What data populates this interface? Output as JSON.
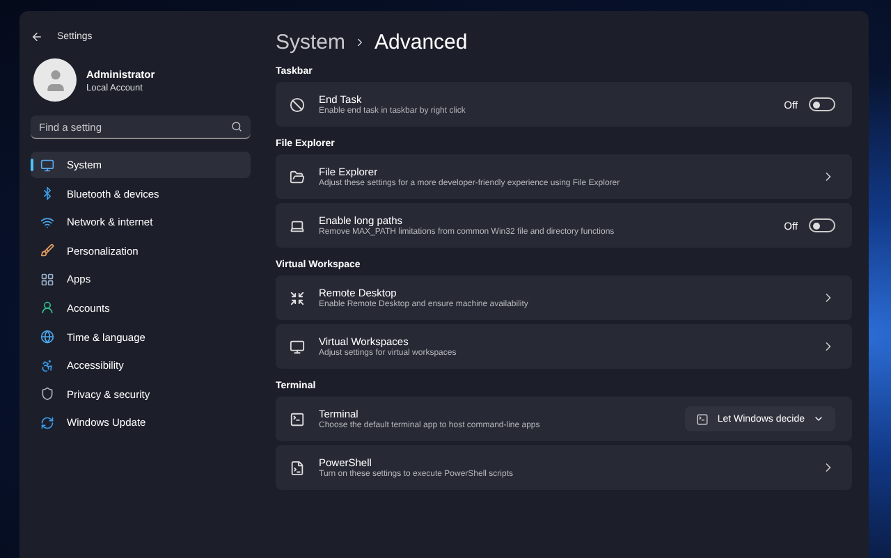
{
  "window": {
    "title": "Settings"
  },
  "user": {
    "name": "Administrator",
    "account": "Local Account"
  },
  "search": {
    "placeholder": "Find a setting"
  },
  "sidebar": {
    "items": [
      {
        "label": "System",
        "selected": true
      },
      {
        "label": "Bluetooth & devices",
        "selected": false
      },
      {
        "label": "Network & internet",
        "selected": false
      },
      {
        "label": "Personalization",
        "selected": false
      },
      {
        "label": "Apps",
        "selected": false
      },
      {
        "label": "Accounts",
        "selected": false
      },
      {
        "label": "Time & language",
        "selected": false
      },
      {
        "label": "Accessibility",
        "selected": false
      },
      {
        "label": "Privacy & security",
        "selected": false
      },
      {
        "label": "Windows Update",
        "selected": false
      }
    ]
  },
  "breadcrumb": {
    "parent": "System",
    "current": "Advanced"
  },
  "sections": [
    {
      "title": "Taskbar",
      "rows": [
        {
          "kind": "toggle",
          "title": "End Task",
          "description": "Enable end task in taskbar by right click",
          "on": false,
          "state": "Off"
        }
      ]
    },
    {
      "title": "File Explorer",
      "rows": [
        {
          "kind": "link",
          "title": "File Explorer",
          "description": "Adjust these settings for a more developer-friendly experience using File Explorer"
        },
        {
          "kind": "toggle",
          "title": "Enable long paths",
          "description": "Remove MAX_PATH limitations from common Win32 file and directory functions",
          "on": false,
          "state": "Off"
        }
      ]
    },
    {
      "title": "Virtual Workspace",
      "rows": [
        {
          "kind": "link",
          "title": "Remote Desktop",
          "description": "Enable Remote Desktop and ensure machine availability"
        },
        {
          "kind": "link",
          "title": "Virtual Workspaces",
          "description": "Adjust settings for virtual workspaces"
        }
      ]
    },
    {
      "title": "Terminal",
      "rows": [
        {
          "kind": "dropdown",
          "title": "Terminal",
          "description": "Choose the default terminal app to host command-line apps",
          "value": "Let Windows decide"
        },
        {
          "kind": "link",
          "title": "PowerShell",
          "description": "Turn on these settings to execute PowerShell scripts"
        }
      ]
    }
  ]
}
